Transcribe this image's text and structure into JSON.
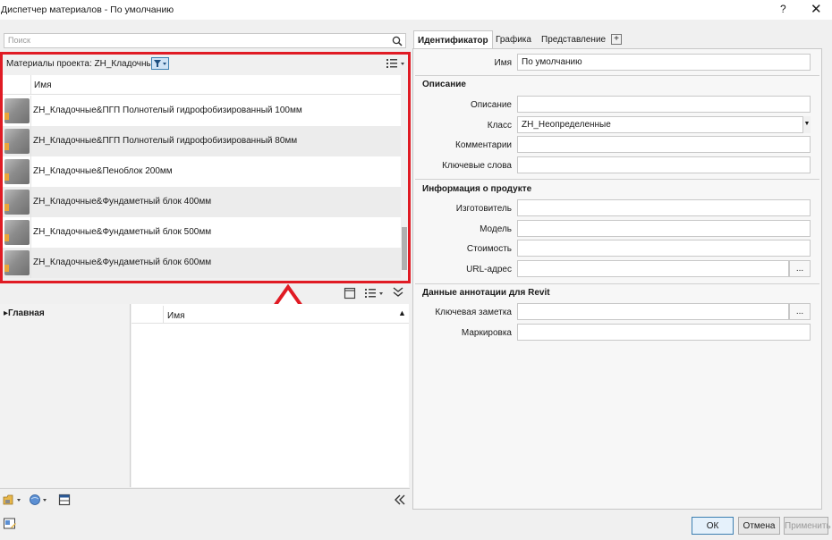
{
  "window": {
    "title": "Диспетчер материалов - По умолчанию",
    "help": "?",
    "close": "✕"
  },
  "search": {
    "placeholder": "Поиск"
  },
  "materials": {
    "header_label": "Материалы проекта: ZH_Кладочные",
    "column_name": "Имя",
    "rows": [
      "ZH_Кладочные&ПГП Полнотелый гидрофобизированный 100мм",
      "ZH_Кладочные&ПГП Полнотелый гидрофобизированный 80мм",
      "ZH_Кладочные&Пеноблок 200мм",
      "ZH_Кладочные&Фундаметный блок 400мм",
      "ZH_Кладочные&Фундаметный блок 500мм",
      "ZH_Кладочные&Фундаметный блок 600мм"
    ]
  },
  "library": {
    "tree_item": "Главная",
    "column_name": "Имя"
  },
  "tabs": [
    {
      "label": "Идентификатор",
      "active": true
    },
    {
      "label": "Графика",
      "active": false
    },
    {
      "label": "Представление",
      "active": false
    }
  ],
  "tab_add": "+",
  "identity": {
    "name_label": "Имя",
    "name_value": "По умолчанию",
    "section_description": "Описание",
    "description_label": "Описание",
    "description_value": "",
    "class_label": "Класс",
    "class_value": "ZH_Неопределенные",
    "comments_label": "Комментарии",
    "comments_value": "",
    "keywords_label": "Ключевые слова",
    "keywords_value": "",
    "section_product": "Информация о продукте",
    "manufacturer_label": "Изготовитель",
    "manufacturer_value": "",
    "model_label": "Модель",
    "model_value": "",
    "cost_label": "Стоимость",
    "cost_value": "",
    "url_label": "URL-адрес",
    "url_value": "",
    "browse": "...",
    "section_revit": "Данные аннотации для Revit",
    "keynote_label": "Ключевая заметка",
    "keynote_value": "",
    "mark_label": "Маркировка",
    "mark_value": ""
  },
  "buttons": {
    "ok": "ОК",
    "cancel": "Отмена",
    "apply": "Применить"
  },
  "colors": {
    "highlight": "#e01b24",
    "accent": "#3c7fb1"
  }
}
